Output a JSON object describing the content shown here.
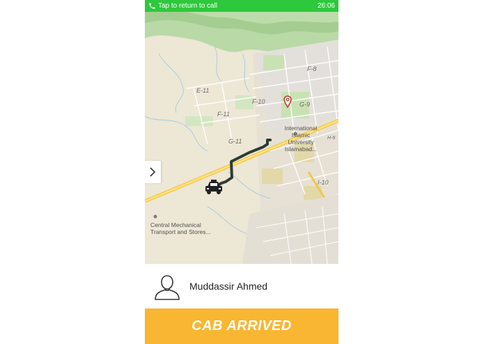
{
  "status_bar": {
    "call_text": "Tap to return to call",
    "time": "26:06",
    "color": "#2dc83c"
  },
  "map": {
    "sector_labels": [
      "F-8",
      "E-11",
      "F-10",
      "G-9",
      "F-11",
      "G-11",
      "I-10",
      "H-9"
    ],
    "poi_university": [
      "International",
      "Islamic",
      "University",
      "Islamabad..."
    ],
    "poi_workshop": [
      "Central Mechanical",
      "Transport and Stores..."
    ],
    "icons": [
      "destination-pin-icon",
      "cab-icon",
      "chevron-right-icon"
    ]
  },
  "driver": {
    "name": "Muddassir Ahmed",
    "avatar_icon": "person-outline-icon"
  },
  "action": {
    "label": "CAB ARRIVED",
    "color": "#f8b632"
  }
}
